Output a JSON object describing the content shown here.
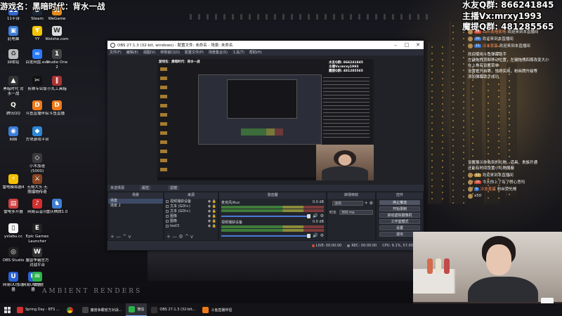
{
  "overlay": {
    "game_title": "游戏名：黑暗时代：背水一战",
    "contact_lines": [
      "水友Q群: 866241845",
      "主播Vx:mrxy1993",
      "魔提Q群: 481285565"
    ]
  },
  "desktop": {
    "brand_watermark": "AMBIENT RENDERS",
    "icons": [
      {
        "label": "11平台",
        "icon": "platform-icon",
        "color": "#3366cc",
        "glyph": "11"
      },
      {
        "label": "Steam",
        "icon": "steam-icon",
        "color": "#1b2838",
        "glyph": "S"
      },
      {
        "label": "WeGame",
        "icon": "wegame-icon",
        "color": "#e08a1a",
        "glyph": "W"
      },
      {
        "label": "此电脑",
        "icon": "computer-icon",
        "color": "#3b7dd8",
        "glyph": "▣"
      },
      {
        "label": "YY",
        "icon": "yy-icon",
        "color": "#f5c400",
        "glyph": "Y"
      },
      {
        "label": "Wolshe.com",
        "icon": "web-icon",
        "color": "#dddddd",
        "glyph": "W"
      },
      {
        "label": "回收站",
        "icon": "recycle-bin-icon",
        "color": "#bbbbbb",
        "glyph": "♻"
      },
      {
        "label": "百度网盘.exe",
        "icon": "netdisk-icon",
        "color": "#2b7bff",
        "glyph": "∞"
      },
      {
        "label": "Studio One 2",
        "icon": "studio-one-icon",
        "color": "#444444",
        "glyph": "1"
      },
      {
        "label": "黑暗时代 背水一战",
        "icon": "game-icon",
        "color": "#333333",
        "glyph": "▲"
      },
      {
        "label": "剪映专业版",
        "icon": "capcut-icon",
        "color": "#111111",
        "glyph": "✂"
      },
      {
        "label": "小丸工具箱",
        "icon": "toolbox-icon",
        "color": "#aa3333",
        "glyph": "∥"
      },
      {
        "label": "腾讯QQ",
        "icon": "qq-icon",
        "color": "#1e1e1e",
        "glyph": "Q"
      },
      {
        "label": "斗鱼直播伴侣",
        "icon": "douyu-icon",
        "color": "#f07a1a",
        "glyph": "D"
      },
      {
        "label": "斗鱼直播",
        "icon": "douyu-live-icon",
        "color": "#f07a1a",
        "glyph": "D"
      },
      {
        "label": "网络",
        "icon": "network-icon",
        "color": "#3b7dd8",
        "glyph": "◉"
      },
      {
        "label": "方块游戏平台",
        "icon": "fangkuai-icon",
        "color": "#2a88d8",
        "glyph": "◆"
      },
      {
        "label": "小木加速 (5000)",
        "icon": "accelerator-icon",
        "color": "#3a3a3a",
        "glyph": "◇"
      },
      {
        "label": "雷电模拟器4",
        "icon": "ldplayer-icon",
        "color": "#f4c000",
        "glyph": "⚡"
      },
      {
        "label": "无限大头·无限爆物传奇",
        "icon": "legend-game-icon",
        "color": "#884422",
        "glyph": "⚔"
      },
      {
        "label": "网易云音乐",
        "icon": "music-icon",
        "color": "#d32f2f",
        "glyph": "♪"
      },
      {
        "label": "雷电多开器",
        "icon": "ldmulti-icon",
        "color": "#d04040",
        "glyph": "▤"
      },
      {
        "label": "重庆棋牌1.0",
        "icon": "chess-icon",
        "color": "#3f7fd0",
        "glyph": "♞"
      },
      {
        "label": "网易UU加速器",
        "icon": "uu-icon",
        "color": "#2a62d6",
        "glyph": "U"
      },
      {
        "label": "yxlabu.cc",
        "icon": "file-icon",
        "color": "#f4f4f4",
        "glyph": "▯"
      },
      {
        "label": "Epic Games Launcher",
        "icon": "epic-icon",
        "color": "#222222",
        "glyph": "E"
      },
      {
        "label": "OBS Studio",
        "icon": "obs-icon",
        "color": "#222222",
        "glyph": "◎"
      },
      {
        "label": "魔兽争霸官方对战平台",
        "icon": "warcraft-icon",
        "color": "#333333",
        "glyph": "W"
      },
      {
        "label": "网易UU加速器",
        "icon": "uu-icon-2",
        "color": "#2a62d6",
        "glyph": "U"
      },
      {
        "label": "微信",
        "icon": "wechat-icon",
        "color": "#2ab34a",
        "glyph": "✉"
      }
    ]
  },
  "chat": {
    "messages": [
      {
        "badge": "44",
        "badge_color": "#d24a3a",
        "user": "sam笑咯笑咯",
        "text": "欢迎来到本直播间"
      },
      {
        "badge": "26",
        "badge_color": "#3a78d2",
        "user": "",
        "text": "欢迎来到本直播间"
      },
      {
        "badge": "15",
        "badge_color": "#3a78d2",
        "user": "冷冻蒸蛋",
        "text": "欢迎来到本直播间"
      }
    ],
    "system_text": "欢迎使用斗鱼弹幕助手\n左键拖拽顶部移动位置，左键拖拽四周改变大小\n在上角有设置菜单\n设置框开启等，觉得实用，粉丝牌升级等\n添加弹幕助手成功",
    "system_text2": "设置展示你收到的礼物、道具、贵族开通\n还能有时间设置小礼物屏蔽",
    "lower_messages": [
      {
        "badge": "12",
        "badge_color": "#c59a3a",
        "user": "",
        "text": "欢迎来到本直播间"
      },
      {
        "badge": "30",
        "badge_color": "#d24a3a",
        "user": "",
        "text": "今天你上了有了赞心思吗"
      },
      {
        "badge": "9",
        "badge_color": "#3a78d2",
        "user": "冷冻蒸蛋",
        "text": "粉丝荧光棒"
      },
      {
        "badge": "",
        "badge_color": "#c59a3a",
        "user": "",
        "text": "x50"
      }
    ]
  },
  "obs": {
    "title": "OBS 27.1.3 (32-bit, windows) - 配置文件: 未命名 - 场景: 未命名",
    "menu": [
      "文件(F)",
      "编辑(E)",
      "视图(V)",
      "停靠窗口(D)",
      "配置文件(P)",
      "场景集合(S)",
      "工具(T)",
      "帮助(H)"
    ],
    "scene_bar": {
      "label": "未选择源",
      "tags": [
        "属性",
        "滤镜"
      ]
    },
    "docks": {
      "scenes": {
        "header": "场景",
        "items": [
          "场景",
          "场景 2"
        ],
        "selected": 0,
        "footer": "+ — ^ v"
      },
      "sources": {
        "header": "来源",
        "items": [
          "视频捕获设备",
          "文本 (GDI+)",
          "文本 (GDI+)",
          "图像",
          "图像",
          "text3"
        ],
        "footer": "+ — ⚙ ^ v"
      },
      "mixer": {
        "header": "混音器",
        "channels": [
          {
            "name": "麦克风/Aux",
            "db": "0.0 dB"
          },
          {
            "name": "视频捕获设备",
            "db": "0.0 dB"
          }
        ]
      },
      "transitions": {
        "header": "转场特效",
        "type": "淡出",
        "duration_label": "时长",
        "duration": "300 ms"
      },
      "controls": {
        "header": "控件",
        "buttons": [
          "停止推流",
          "开始录制",
          "启动虚拟摄像机",
          "工作室模式",
          "设置",
          "退出"
        ]
      }
    },
    "status": {
      "live": "LIVE: 00:00:00",
      "rec": "REC: 00:00:00",
      "cpu": "CPU: 9.1%, 57.00 fps"
    }
  },
  "taskbar": {
    "items": [
      {
        "label": "Spring Day - BTS ...",
        "icon": "music-task-icon",
        "color": "#d32f2f",
        "active": false
      },
      {
        "label": "",
        "icon": "chrome-icon",
        "color": "#e8b43a",
        "active": false
      },
      {
        "label": "魔兽争霸官方对战...",
        "icon": "warcraft-task-icon",
        "color": "#444444",
        "active": false
      },
      {
        "label": "微信",
        "icon": "wechat-task-icon",
        "color": "#2ab34a",
        "active": true
      },
      {
        "label": "OBS 27.1.3 (32-bit...",
        "icon": "obs-task-icon",
        "color": "#333333",
        "active": false
      },
      {
        "label": "斗鱼直播伴侣",
        "icon": "douyu-task-icon",
        "color": "#f07a1a",
        "active": false
      }
    ]
  }
}
